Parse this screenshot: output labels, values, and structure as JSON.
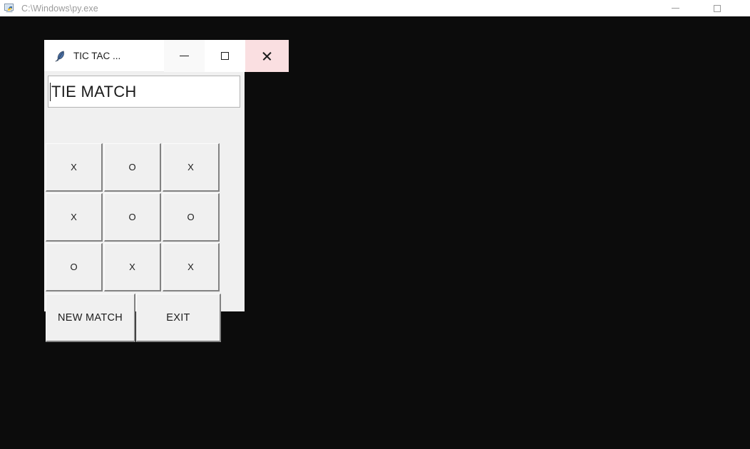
{
  "console_window": {
    "title": "C:\\Windows\\py.exe",
    "icon": "python-console-icon",
    "background_color": "#0c0c0c",
    "titlebar_color": "#ffffff",
    "controls": {
      "minimize_label": "—",
      "minimize_icon": "minimize-icon",
      "maximize_icon": "maximize-icon"
    }
  },
  "tk_window": {
    "title": "TIC TAC ...",
    "icon": "feather-icon",
    "titlebar_color": "#ffffff",
    "client_color": "#f0f0f0",
    "controls": {
      "minimize_icon": "minimize-icon",
      "maximize_icon": "maximize-icon",
      "close_icon": "close-icon",
      "close_hover_color": "#fadfe1"
    },
    "status": {
      "value": "TIE MATCH",
      "placeholder": "",
      "background_color": "#ffffff",
      "border_color": "#b4b4b4"
    },
    "board": {
      "rows": [
        [
          "X",
          "O",
          "X"
        ],
        [
          "X",
          "O",
          "O"
        ],
        [
          "O",
          "X",
          "X"
        ]
      ],
      "cells": [
        "X",
        "O",
        "X",
        "X",
        "O",
        "O",
        "O",
        "X",
        "X"
      ],
      "button_face_color": "#f0f0f0"
    },
    "actions": {
      "new_match_label": "NEW MATCH",
      "exit_label": "EXIT"
    }
  }
}
